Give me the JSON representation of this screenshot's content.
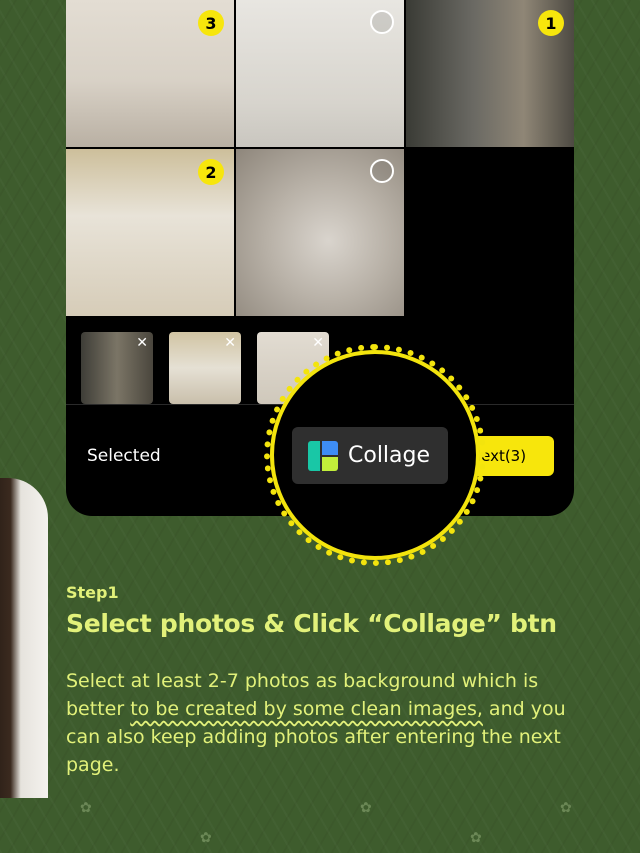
{
  "photos": [
    {
      "id": "p1",
      "badge": "3"
    },
    {
      "id": "p2",
      "badge": ""
    },
    {
      "id": "p3",
      "badge": "1"
    },
    {
      "id": "p4",
      "badge": "2"
    },
    {
      "id": "p5",
      "badge": ""
    }
  ],
  "thumbs_close": "✕",
  "bottom_bar": {
    "selected_label": "Selected",
    "next_label": "Next(3)",
    "collage_label": "Collage"
  },
  "step": {
    "label": "Step1",
    "heading": "Select photos & Click “Collage” btn",
    "body_part1": "Select at least 2-7 photos as background which is better ",
    "body_underlined": "to be created by some clean images,",
    "body_part2": " and you can also keep adding photos after entering the next page."
  },
  "colors": {
    "accent": "#f7e60c",
    "background": "#3e5c2d",
    "text": "#e2f17a"
  }
}
